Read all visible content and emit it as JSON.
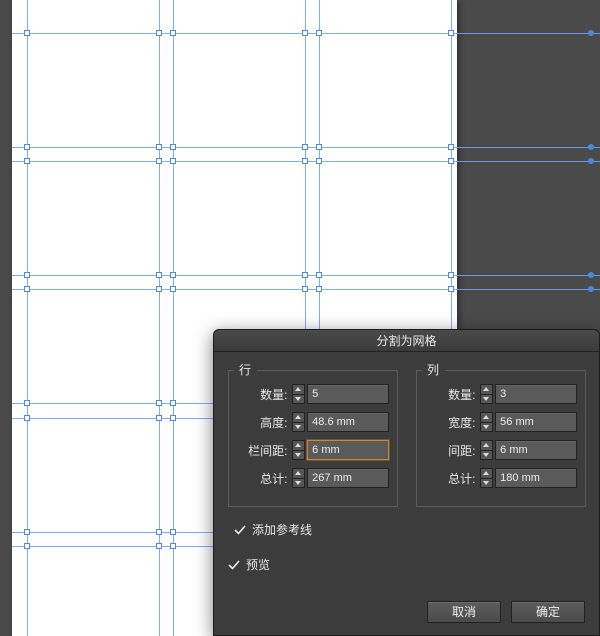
{
  "dialog": {
    "title": "分割为网格",
    "rows": {
      "legend": "行",
      "count_label": "数量:",
      "count_value": "5",
      "height_label": "高度:",
      "height_value": "48.6 mm",
      "gutter_label": "栏间距:",
      "gutter_value": "6 mm",
      "total_label": "总计:",
      "total_value": "267 mm"
    },
    "cols": {
      "legend": "列",
      "count_label": "数量:",
      "count_value": "3",
      "width_label": "宽度:",
      "width_value": "56 mm",
      "gutter_label": "间距:",
      "gutter_value": "6 mm",
      "total_label": "总计:",
      "total_value": "180 mm"
    },
    "add_guides_label": "添加参考线",
    "preview_label": "预览",
    "cancel_label": "取消",
    "ok_label": "确定"
  },
  "guides": {
    "h": [
      33,
      147,
      161,
      275,
      289,
      403,
      418,
      532,
      546
    ],
    "v": [
      27,
      159,
      173,
      305,
      319,
      451
    ]
  }
}
